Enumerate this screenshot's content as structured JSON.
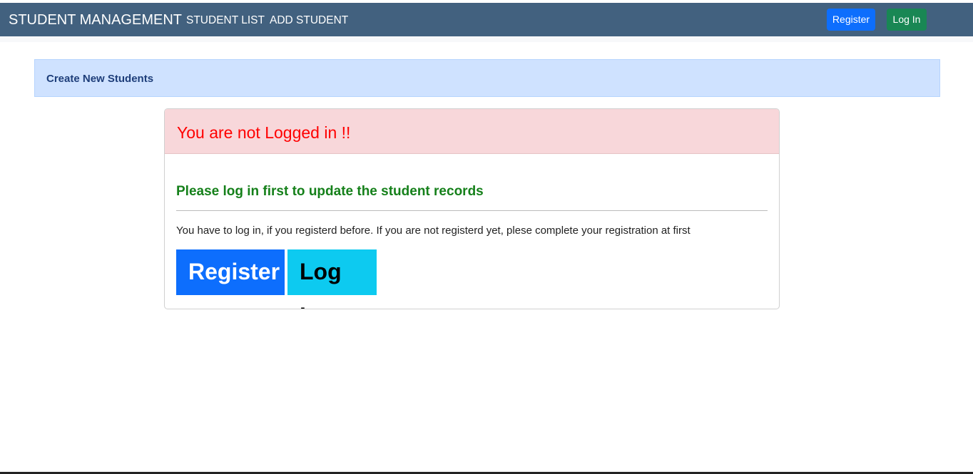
{
  "navbar": {
    "brand": "STUDENT MANAGEMENT",
    "links": [
      "STUDENT LIST",
      "ADD STUDENT"
    ],
    "register": "Register",
    "login": "Log In"
  },
  "banner": {
    "title": "Create New Students"
  },
  "card": {
    "header": "You are not Logged in !!",
    "subtitle": "Please log in first to update the student records",
    "text": "You have to log in, if you registerd before. If you are not registerd yet, plese complete your registration at first",
    "register": "Register",
    "login": "Log In"
  },
  "colors": {
    "navbar": "#42617f",
    "register": "#0d6efd",
    "login_nav": "#198754",
    "login_card": "#0dcaf0",
    "alert": "#f8d7da"
  }
}
